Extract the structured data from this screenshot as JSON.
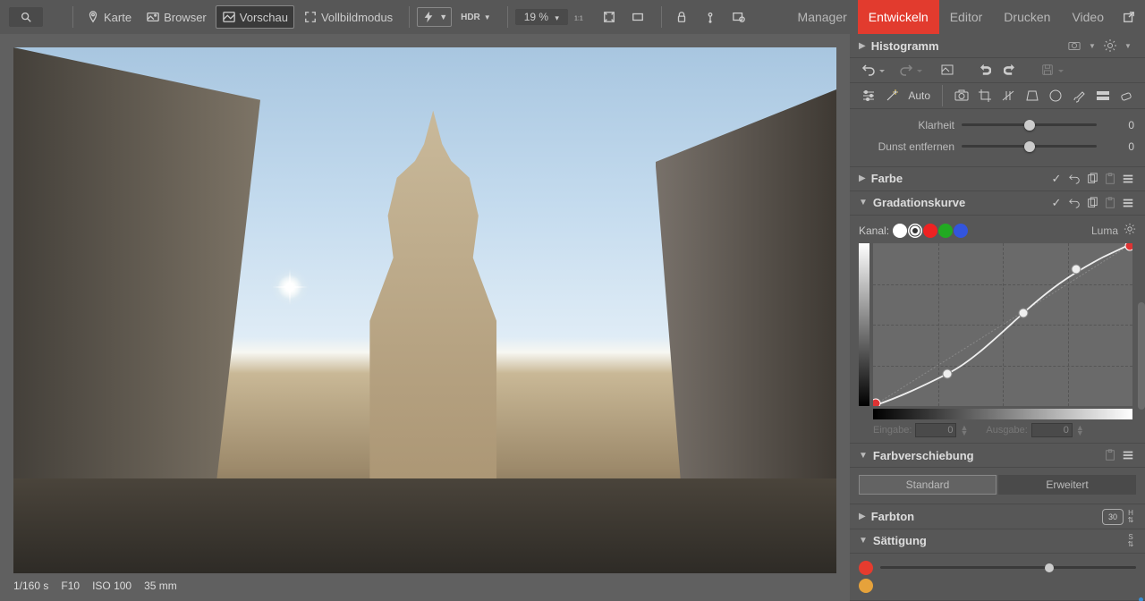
{
  "topbar": {
    "karte": "Karte",
    "browser": "Browser",
    "vorschau": "Vorschau",
    "vollbild": "Vollbildmodus",
    "hdr": "HDR",
    "zoom": "19 %",
    "zoom_dd": "▾"
  },
  "modules": {
    "manager": "Manager",
    "entwickeln": "Entwickeln",
    "editor": "Editor",
    "drucken": "Drucken",
    "video": "Video"
  },
  "exif": {
    "shutter": "1/160 s",
    "aperture": "F10",
    "iso": "ISO 100",
    "focal": "35 mm"
  },
  "panel": {
    "histogram": "Histogramm",
    "auto": "Auto",
    "slider_klarheit": {
      "label": "Klarheit",
      "value": "0"
    },
    "slider_dunst": {
      "label": "Dunst entfernen",
      "value": "0"
    },
    "farbe": "Farbe",
    "curve": "Gradationskurve",
    "kanal": "Kanal:",
    "luma": "Luma",
    "eingabe": "Eingabe:",
    "eingabe_val": "0",
    "ausgabe": "Ausgabe:",
    "ausgabe_val": "0",
    "farbverschiebung": "Farbverschiebung",
    "standard": "Standard",
    "erweitert": "Erweitert",
    "farbton": "Farbton",
    "badge30": "30",
    "saettigung": "Sättigung"
  },
  "chart_data": {
    "type": "line",
    "title": "Gradationskurve",
    "xlabel": "Eingabe",
    "ylabel": "Ausgabe",
    "xlim": [
      0,
      255
    ],
    "ylim": [
      0,
      255
    ],
    "channel": "Luma",
    "points": [
      {
        "x": 0,
        "y": 0
      },
      {
        "x": 73,
        "y": 50
      },
      {
        "x": 148,
        "y": 146
      },
      {
        "x": 200,
        "y": 215
      },
      {
        "x": 255,
        "y": 255
      }
    ]
  }
}
